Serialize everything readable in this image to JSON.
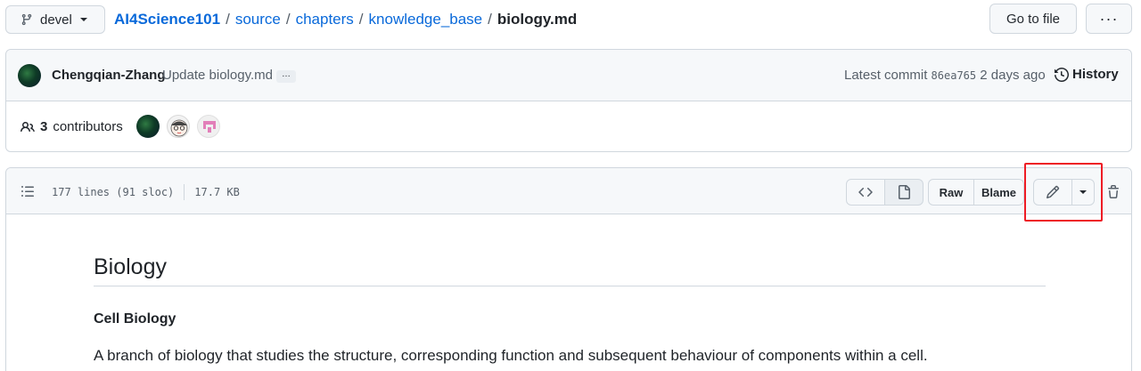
{
  "header": {
    "branch": "devel",
    "breadcrumb": {
      "repo": "AI4Science101",
      "path": [
        "source",
        "chapters",
        "knowledge_base"
      ],
      "separator": "/",
      "file": "biology.md"
    },
    "goto_file_label": "Go to file",
    "more_label": "···"
  },
  "commit": {
    "author": "Chengqian-Zhang",
    "message": "Update biology.md",
    "ellipsis": "…",
    "latest_label": "Latest commit",
    "sha": "86ea765",
    "time": "2 days ago",
    "history_label": "History"
  },
  "contributors": {
    "count": "3",
    "label": "contributors"
  },
  "file": {
    "lines": "177 lines (91 sloc)",
    "size": "17.7 KB",
    "raw_label": "Raw",
    "blame_label": "Blame"
  },
  "content": {
    "title": "Biology",
    "subtitle": "Cell Biology",
    "paragraph": "A branch of biology that studies the structure, corresponding function and subsequent behaviour of components within a cell."
  },
  "colors": {
    "link": "#0969da",
    "border": "#d0d7de",
    "highlight": "#ee1c25",
    "header_bg": "#f6f8fa"
  }
}
